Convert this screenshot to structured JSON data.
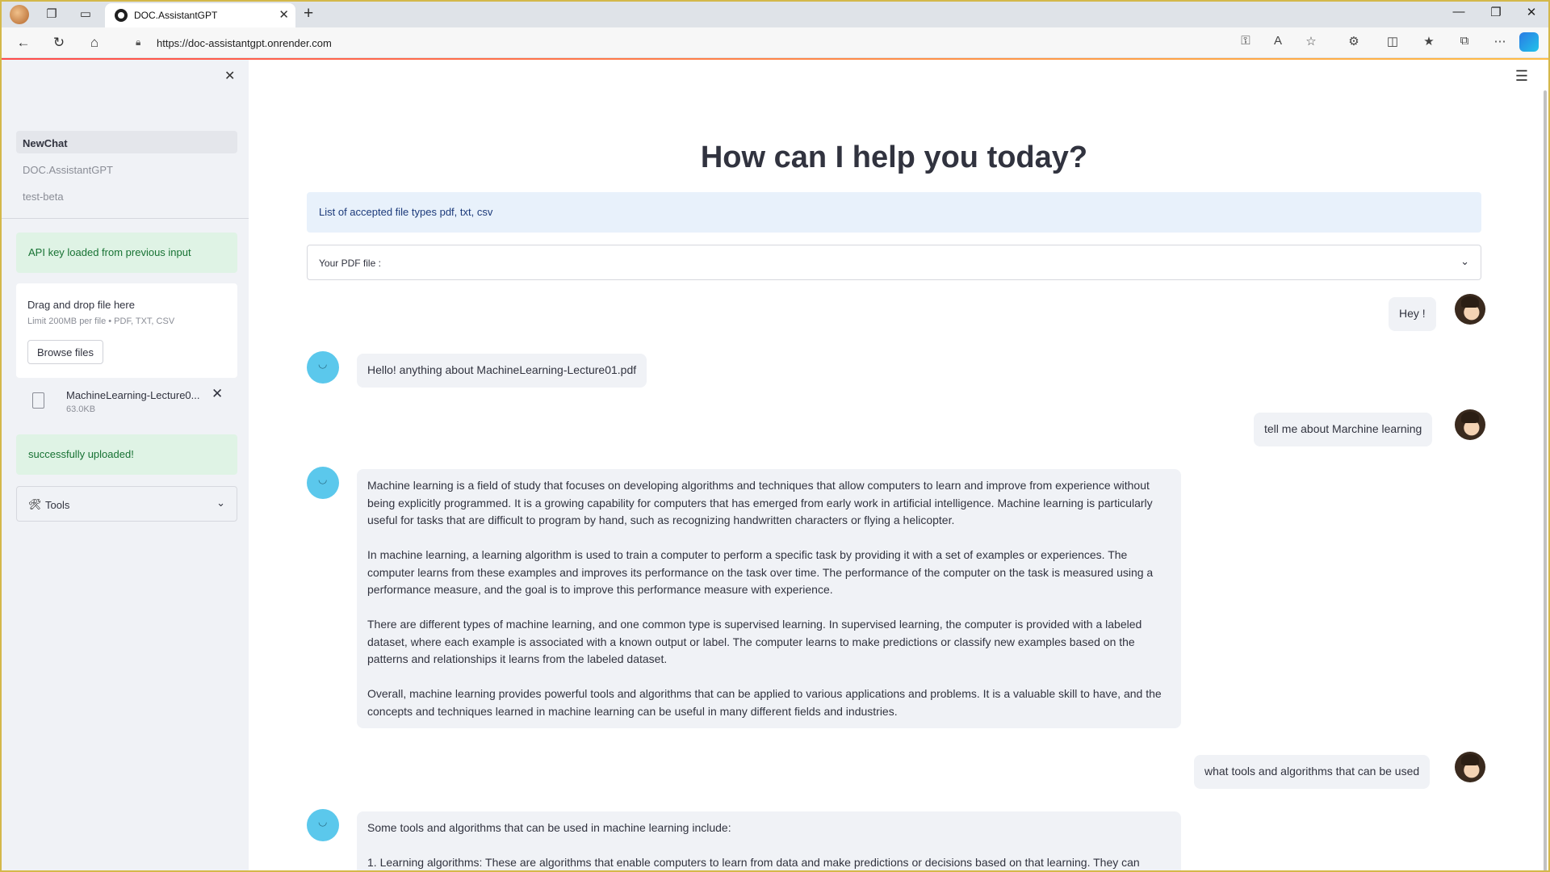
{
  "browser": {
    "tab_title": "DOC.AssistantGPT",
    "url": "https://doc-assistantgpt.onrender.com"
  },
  "sidebar": {
    "chats": [
      {
        "label": "NewChat",
        "active": true
      },
      {
        "label": "DOC.AssistantGPT",
        "active": false
      },
      {
        "label": "test-beta",
        "active": false
      }
    ],
    "api_alert": "API key loaded from previous input",
    "uploader": {
      "title": "Drag and drop file here",
      "limit": "Limit 200MB per file • PDF, TXT, CSV",
      "browse_label": "Browse files"
    },
    "file": {
      "name": "MachineLearning-Lecture0...",
      "size": "63.0KB"
    },
    "upload_status": "successfully uploaded!",
    "tools_label": "Tools"
  },
  "main": {
    "heading": "How can I help you today?",
    "info": "List of accepted file types pdf, txt, csv",
    "expander_label": "Your PDF file :",
    "messages": [
      {
        "role": "user",
        "text": "Hey !"
      },
      {
        "role": "assistant",
        "text": "Hello! anything about MachineLearning-Lecture01.pdf"
      },
      {
        "role": "user",
        "text": "tell me about Marchine learning"
      },
      {
        "role": "assistant",
        "paragraphs": [
          "Machine learning is a field of study that focuses on developing algorithms and techniques that allow computers to learn and improve from experience without being explicitly programmed. It is a growing capability for computers that has emerged from early work in artificial intelligence. Machine learning is particularly useful for tasks that are difficult to program by hand, such as recognizing handwritten characters or flying a helicopter.",
          "In machine learning, a learning algorithm is used to train a computer to perform a specific task by providing it with a set of examples or experiences. The computer learns from these examples and improves its performance on the task over time. The performance of the computer on the task is measured using a performance measure, and the goal is to improve this performance measure with experience.",
          "There are different types of machine learning, and one common type is supervised learning. In supervised learning, the computer is provided with a labeled dataset, where each example is associated with a known output or label. The computer learns to make predictions or classify new examples based on the patterns and relationships it learns from the labeled dataset.",
          "Overall, machine learning provides powerful tools and algorithms that can be applied to various applications and problems. It is a valuable skill to have, and the concepts and techniques learned in machine learning can be useful in many different fields and industries."
        ]
      },
      {
        "role": "user",
        "text": "what tools and algorithms that can be used"
      },
      {
        "role": "assistant",
        "paragraphs": [
          "Some tools and algorithms that can be used in machine learning include:",
          "1. Learning algorithms: These are algorithms that enable computers to learn from data and make predictions or decisions based on that learning. They can"
        ]
      }
    ]
  }
}
